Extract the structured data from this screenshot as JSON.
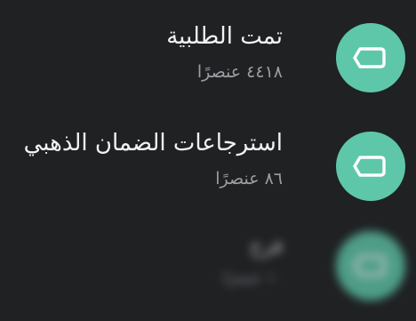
{
  "labels": [
    {
      "name": "تمت الطلبية",
      "count": "٤٤١٨ عنصرًا",
      "icon": "label-tag-icon",
      "color": "#5ec7a9"
    },
    {
      "name": "استرجاعات الضمان الذهبي",
      "count": "٨٦ عنصرًا",
      "icon": "label-tag-icon",
      "color": "#5ec7a9"
    },
    {
      "name": "فرح",
      "count": "١٠ عنصرًا",
      "icon": "label-tag-icon",
      "color": "#5ec7a9"
    }
  ]
}
